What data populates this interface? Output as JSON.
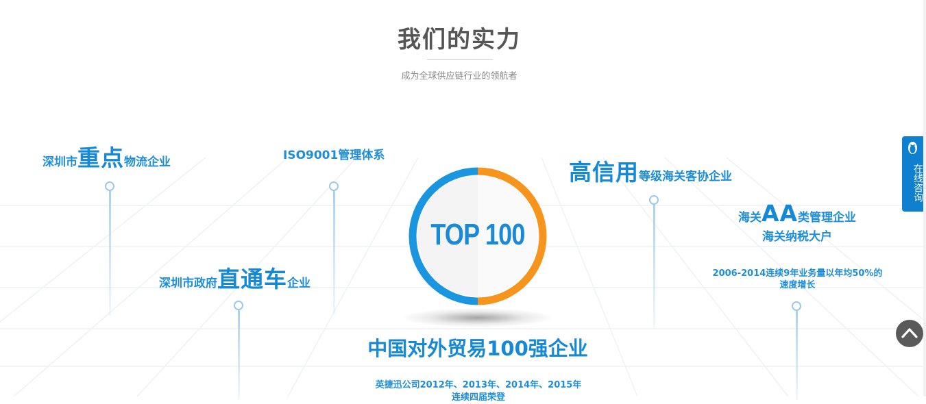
{
  "section": {
    "title": "我们的实力",
    "subtitle": "成为全球供应链行业的领航者"
  },
  "features": {
    "shenzhen_key": {
      "prefix": "深圳市",
      "big": "重点",
      "suffix": "物流企业"
    },
    "iso": {
      "text": "ISO9001管理体系"
    },
    "direct": {
      "prefix": "深圳市政府",
      "big": "直通车",
      "suffix": "企业"
    },
    "credit": {
      "big": "高信用",
      "suffix": "等级海关客协企业"
    },
    "customs_aa": {
      "prefix": "海关",
      "big": "AA",
      "suffix": "类管理企业",
      "line2": "海关纳税大户"
    },
    "growth": {
      "line1": "2006-2014连续9年业务量以年均50%的",
      "line2": "速度增长"
    }
  },
  "center": {
    "badge": "TOP 100",
    "award": "中国对外贸易100强企业",
    "note_line1": "英捷迅公司2012年、2013年、2014年、2015年",
    "note_line2": "连续四届荣登"
  },
  "sidebar": {
    "online_label": "在线咨询"
  },
  "colors": {
    "brand_blue": "#1589d6",
    "ring_orange": "#f7941d",
    "ring_blue": "#1a96e0",
    "title_gray": "#555555"
  },
  "icons": {
    "online_tab_icon": "qq-penguin-icon",
    "back_to_top": "chevron-up-icon"
  }
}
